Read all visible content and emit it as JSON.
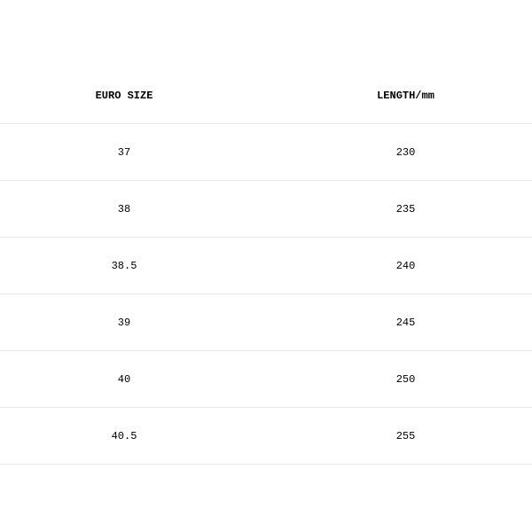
{
  "table": {
    "headers": {
      "col1": "EURO SIZE",
      "col2": "LENGTH/mm"
    },
    "rows": [
      {
        "euro_size": "37",
        "length": "230"
      },
      {
        "euro_size": "38",
        "length": "235"
      },
      {
        "euro_size": "38.5",
        "length": "240"
      },
      {
        "euro_size": "39",
        "length": "245"
      },
      {
        "euro_size": "40",
        "length": "250"
      },
      {
        "euro_size": "40.5",
        "length": "255"
      }
    ]
  }
}
